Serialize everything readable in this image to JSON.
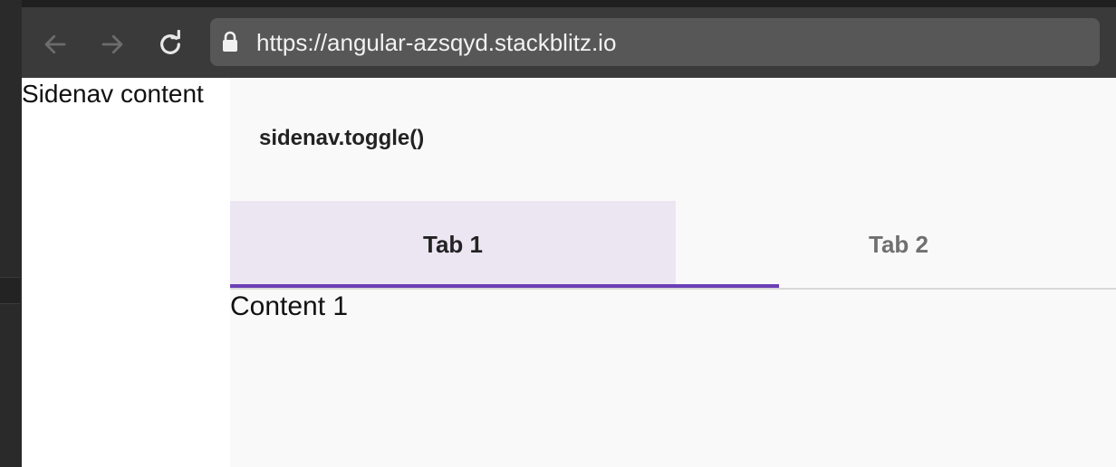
{
  "browser": {
    "url": "https://angular-azsqyd.stackblitz.io",
    "icons": [
      "back-arrow-icon",
      "forward-arrow-icon",
      "reload-icon",
      "lock-icon"
    ]
  },
  "sidenav": {
    "text": "Sidenav content"
  },
  "main": {
    "toggle_label": "sidenav.toggle()",
    "tabs": [
      {
        "label": "Tab 1",
        "active": true
      },
      {
        "label": "Tab 2",
        "active": false
      }
    ],
    "content": "Content 1"
  },
  "colors": {
    "accent": "#6a3fb5",
    "active_tab_bg": "#ece6f3"
  }
}
